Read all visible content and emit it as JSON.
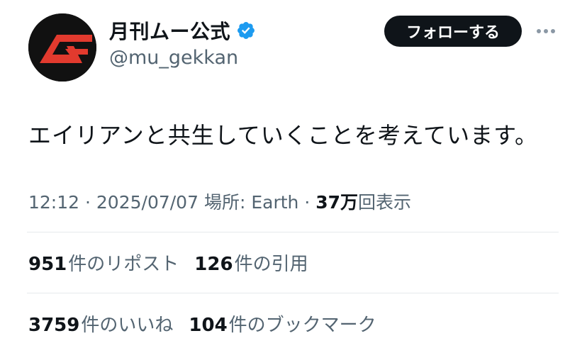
{
  "account": {
    "display_name": "月刊ムー公式",
    "handle": "@mu_gekkan",
    "verified_icon": "verified-badge-icon",
    "avatar_icon": "mu-logo-icon"
  },
  "actions": {
    "follow_label": "フォローする",
    "more_icon": "more-icon"
  },
  "tweet": {
    "text": "エイリアンと共生していくことを考えています。",
    "time": "12:12",
    "separator": "·",
    "date": "2025/07/07",
    "location": "場所: Earth",
    "views_count": "37万",
    "views_label": "回表示"
  },
  "stats": {
    "reposts": {
      "count": "951",
      "label": "件のリポスト"
    },
    "quotes": {
      "count": "126",
      "label": "件の引用"
    },
    "likes": {
      "count": "3759",
      "label": "件のいいね"
    },
    "bookmarks": {
      "count": "104",
      "label": "件のブックマーク"
    }
  },
  "colors": {
    "text_primary": "#0f1419",
    "text_secondary": "#536471",
    "verified_blue": "#1d9bf0",
    "logo_red": "#e23a2e",
    "divider": "#e6e9ec"
  }
}
